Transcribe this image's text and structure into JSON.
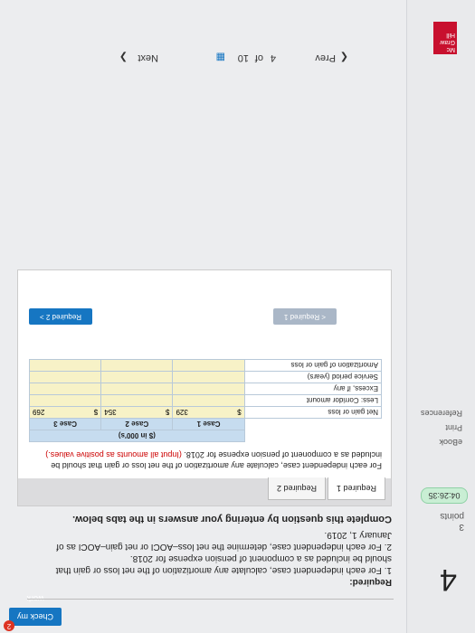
{
  "header": {
    "check_label": "Check my work",
    "badge_count": "2"
  },
  "question": {
    "number": "4",
    "points_value": "3",
    "points_label": "points",
    "timer": "04:26:35"
  },
  "rail": {
    "ebook": "eBook",
    "print": "Print",
    "references": "References"
  },
  "requirements": {
    "heading": "Required:",
    "line1": "1. For each independent case, calculate any amortization of the net loss or gain that should be included as a component of pension expense for 2018.",
    "line2": "2. For each independent case, determine the net loss–AOCI or net gain–AOCI as of January 1, 2019."
  },
  "instruction": "Complete this question by entering your answers in the tabs below.",
  "tabs": [
    {
      "label": "Required 1"
    },
    {
      "label": "Required 2"
    }
  ],
  "task": {
    "text": "For each independent case, calculate any amortization of the net loss or gain that should be included as a component of pension expense for 2018.",
    "hint": "(Input all amounts as positive values.)"
  },
  "table": {
    "unit_header": "($ in 000's)",
    "columns": [
      "Case 1",
      "Case 2",
      "Case 3"
    ],
    "rows": [
      {
        "label": "Net gain or loss",
        "symbol": "$",
        "values": [
          "329",
          "354",
          "269"
        ]
      },
      {
        "label": "Less: Corridor amount",
        "symbol": "",
        "values": [
          "",
          "",
          ""
        ]
      },
      {
        "label": "Excess, if any",
        "symbol": "",
        "values": [
          "",
          "",
          ""
        ]
      },
      {
        "label": "Service period (years)",
        "symbol": "",
        "values": [
          "",
          "",
          ""
        ]
      },
      {
        "label": "Amortization of gain or loss",
        "symbol": "",
        "values": [
          "",
          "",
          ""
        ]
      }
    ]
  },
  "panel_nav": {
    "prev_label": "< Required 1",
    "next_label": "Required 2 >"
  },
  "pager": {
    "prev": "Prev",
    "current": "4",
    "of": "of",
    "total": "10",
    "next": "Next"
  },
  "logo": {
    "text": "Mc Graw Hill"
  }
}
